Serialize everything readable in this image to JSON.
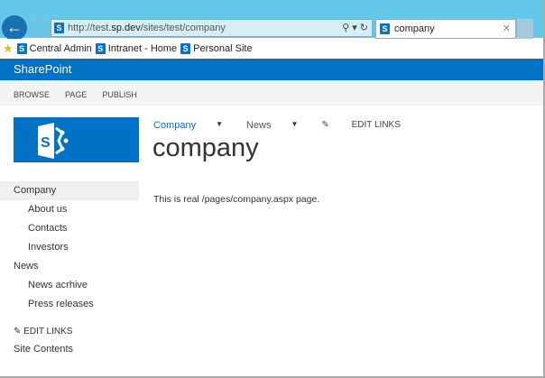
{
  "browser": {
    "url_prefix": "http://test.",
    "url_host": "sp.dev",
    "url_path": "/sites/test/company",
    "tab_title": "company",
    "search_icon": "⚲ ▾ ↻"
  },
  "favorites": [
    "Central Admin",
    "Intranet - Home",
    "Personal Site"
  ],
  "suite_title": "SharePoint",
  "ribbon": [
    "BROWSE",
    "PAGE",
    "PUBLISH"
  ],
  "topnav": {
    "items": [
      "Company",
      "News"
    ],
    "edit": "EDIT LINKS"
  },
  "page_title": "company",
  "body_text": "This is real /pages/company.aspx page.",
  "leftnav": [
    {
      "label": "Company"
    },
    {
      "label": "About us"
    },
    {
      "label": "Contacts"
    },
    {
      "label": "Investors"
    },
    {
      "label": "News"
    },
    {
      "label": "News acrhive"
    },
    {
      "label": "Press releases"
    }
  ],
  "left_edit": "EDIT LINKS",
  "site_contents": "Site Contents",
  "accent": "#0072c6"
}
